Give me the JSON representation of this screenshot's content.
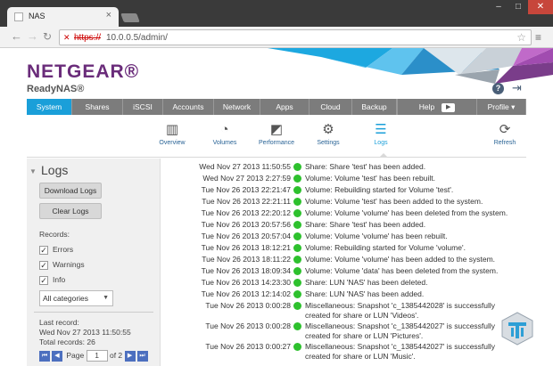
{
  "browser": {
    "tab_title": "NAS",
    "tab_close": "×",
    "url_scheme": "https://",
    "url_rest": "10.0.0.5/admin/"
  },
  "header": {
    "logo": "NETGEAR®",
    "product": "ReadyNAS®",
    "help": "?"
  },
  "main_nav": [
    {
      "label": "System",
      "active": true
    },
    {
      "label": "Shares"
    },
    {
      "label": "iSCSI"
    },
    {
      "label": "Accounts"
    },
    {
      "label": "Network"
    },
    {
      "label": "Apps"
    },
    {
      "label": "Cloud"
    },
    {
      "label": "Backup"
    },
    {
      "label": "Help"
    },
    {
      "label": "Profile ▾"
    }
  ],
  "sub_nav": [
    {
      "label": "Overview",
      "icon": "overview-icon"
    },
    {
      "label": "Volumes",
      "icon": "volumes-icon"
    },
    {
      "label": "Performance",
      "icon": "performance-icon"
    },
    {
      "label": "Settings",
      "icon": "settings-icon"
    },
    {
      "label": "Logs",
      "icon": "logs-icon",
      "active": true
    },
    {
      "label": "Refresh",
      "icon": "refresh-icon"
    }
  ],
  "panel": {
    "title": "Logs",
    "download_label": "Download Logs",
    "clear_label": "Clear Logs",
    "records_label": "Records:",
    "filters": [
      {
        "label": "Errors",
        "checked": true
      },
      {
        "label": "Warnings",
        "checked": true
      },
      {
        "label": "Info",
        "checked": true
      }
    ],
    "category_selected": "All categories",
    "last_record_label": "Last record:",
    "last_record_value": "Wed Nov 27 2013 11:50:55",
    "total_records": "Total records: 26",
    "page_label": "Page",
    "page_value": "1",
    "page_of": "of 2"
  },
  "colors": {
    "accent": "#1a9fd9",
    "brand": "#6a2c7a",
    "status_ok": "#2ec12e"
  },
  "logs": [
    {
      "ts": "Wed Nov 27 2013 11:50:55",
      "msg": "Share: Share 'test' has been added."
    },
    {
      "ts": "Wed Nov 27 2013 2:27:59",
      "msg": "Volume: Volume 'test' has been rebuilt."
    },
    {
      "ts": "Tue Nov 26 2013 22:21:47",
      "msg": "Volume: Rebuilding started for Volume 'test'."
    },
    {
      "ts": "Tue Nov 26 2013 22:21:11",
      "msg": "Volume: Volume 'test' has been added to the system."
    },
    {
      "ts": "Tue Nov 26 2013 22:20:12",
      "msg": "Volume: Volume 'volume' has been deleted from the system."
    },
    {
      "ts": "Tue Nov 26 2013 20:57:56",
      "msg": "Share: Share 'test' has been added."
    },
    {
      "ts": "Tue Nov 26 2013 20:57:04",
      "msg": "Volume: Volume 'volume' has been rebuilt."
    },
    {
      "ts": "Tue Nov 26 2013 18:12:21",
      "msg": "Volume: Rebuilding started for Volume 'volume'."
    },
    {
      "ts": "Tue Nov 26 2013 18:11:22",
      "msg": "Volume: Volume 'volume' has been added to the system."
    },
    {
      "ts": "Tue Nov 26 2013 18:09:34",
      "msg": "Volume: Volume 'data' has been deleted from the system."
    },
    {
      "ts": "Tue Nov 26 2013 14:23:30",
      "msg": "Share: LUN 'NAS' has been deleted."
    },
    {
      "ts": "Tue Nov 26 2013 12:14:02",
      "msg": "Share: LUN 'NAS' has been added."
    },
    {
      "ts": "Tue Nov 26 2013 0:00:28",
      "msg": "Miscellaneous: Snapshot 'c_1385442028' is successfully",
      "msg2": "created for share or LUN 'Videos'."
    },
    {
      "ts": "Tue Nov 26 2013 0:00:28",
      "msg": "Miscellaneous: Snapshot 'c_1385442027' is successfully",
      "msg2": "created for share or LUN 'Pictures'."
    },
    {
      "ts": "Tue Nov 26 2013 0:00:27",
      "msg": "Miscellaneous: Snapshot 'c_1385442027' is successfully",
      "msg2": "created for share or LUN 'Music'."
    }
  ]
}
